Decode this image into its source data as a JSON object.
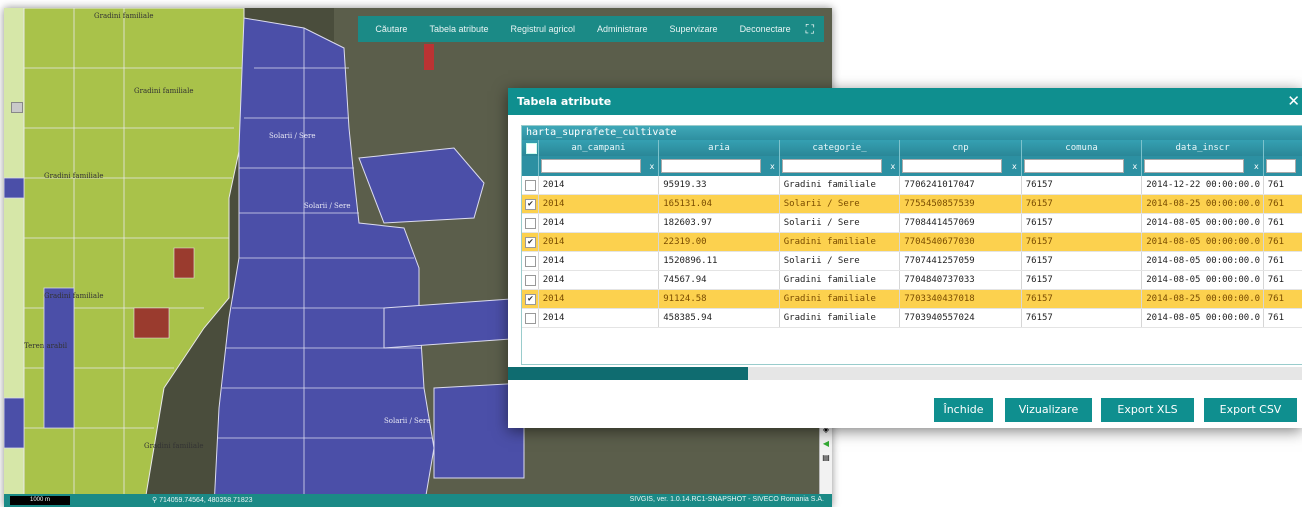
{
  "nav": {
    "items": [
      "Căutare",
      "Tabela atribute",
      "Registrul agricol",
      "Administrare",
      "Supervizare",
      "Deconectare"
    ],
    "fullscreen_icon": "fullscreen-icon"
  },
  "map_labels": [
    "Gradini familiale",
    "Solarii / Sere",
    "Teren arabil"
  ],
  "status": {
    "scale": "1000 m",
    "coords": "714059.74564, 480358.71823",
    "version": "SIVGIS, ver. 1.0.14.RC1-SNAPSHOT - SIVECO Romania S.A."
  },
  "dialog": {
    "title": "Tabela atribute",
    "close": "✕",
    "table_title": "harta_suprafete_cultivate",
    "columns": [
      "an_campani",
      "aria",
      "categorie_",
      "cnp",
      "comuna",
      "data_inscr"
    ],
    "filter_clear": "x",
    "rows": [
      {
        "checked": false,
        "an": "2014",
        "aria": "95919.33",
        "categorie": "Gradini familiale",
        "cnp": "7706241017047",
        "comuna": "76157",
        "data": "2014-12-22 00:00:00.0",
        "extra": "761"
      },
      {
        "checked": true,
        "an": "2014",
        "aria": "165131.04",
        "categorie": "Solarii / Sere",
        "cnp": "7755450857539",
        "comuna": "76157",
        "data": "2014-08-25 00:00:00.0",
        "extra": "761"
      },
      {
        "checked": false,
        "an": "2014",
        "aria": "182603.97",
        "categorie": "Solarii / Sere",
        "cnp": "7708441457069",
        "comuna": "76157",
        "data": "2014-08-05 00:00:00.0",
        "extra": "761"
      },
      {
        "checked": true,
        "an": "2014",
        "aria": "22319.00",
        "categorie": "Gradini familiale",
        "cnp": "7704540677030",
        "comuna": "76157",
        "data": "2014-08-05 00:00:00.0",
        "extra": "761"
      },
      {
        "checked": false,
        "an": "2014",
        "aria": "1520896.11",
        "categorie": "Solarii / Sere",
        "cnp": "7707441257059",
        "comuna": "76157",
        "data": "2014-08-05 00:00:00.0",
        "extra": "761"
      },
      {
        "checked": false,
        "an": "2014",
        "aria": "74567.94",
        "categorie": "Gradini familiale",
        "cnp": "7704840737033",
        "comuna": "76157",
        "data": "2014-08-05 00:00:00.0",
        "extra": "761"
      },
      {
        "checked": true,
        "an": "2014",
        "aria": "91124.58",
        "categorie": "Gradini familiale",
        "cnp": "7703340437018",
        "comuna": "76157",
        "data": "2014-08-25 00:00:00.0",
        "extra": "761"
      },
      {
        "checked": false,
        "an": "2014",
        "aria": "458385.94",
        "categorie": "Gradini familiale",
        "cnp": "7703940557024",
        "comuna": "76157",
        "data": "2014-08-05 00:00:00.0",
        "extra": "761"
      }
    ],
    "buttons": [
      "Închide",
      "Vizualizare",
      "Export XLS",
      "Export CSV"
    ]
  },
  "colors": {
    "accent": "#0f8f8f",
    "selected_row": "#fcd14e",
    "parcel_green": "#a9c24a",
    "parcel_purple": "#4b4fa8"
  }
}
